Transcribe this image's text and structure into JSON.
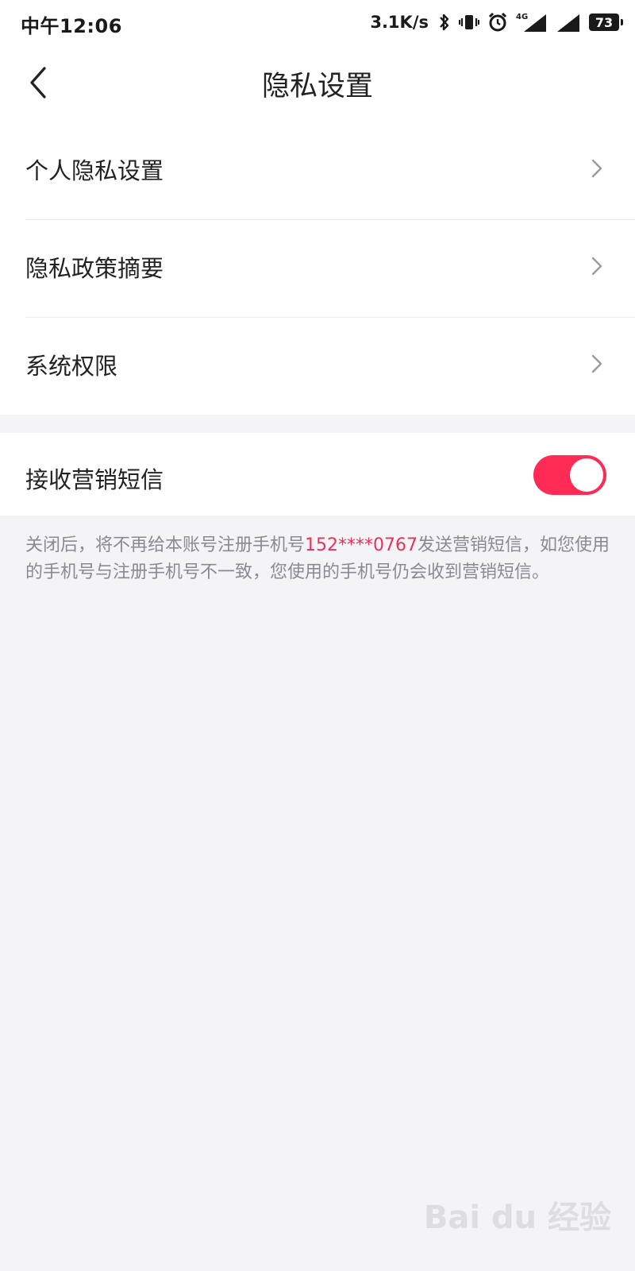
{
  "status_bar": {
    "time": "中午12:06",
    "network_speed": "3.1K/s",
    "network_type": "4G",
    "battery": "73",
    "icons": [
      "bluetooth-icon",
      "vibrate-icon",
      "alarm-icon",
      "signal-icon",
      "signal-icon",
      "battery-icon"
    ]
  },
  "header": {
    "title": "隐私设置",
    "back_icon": "chevron-left-icon"
  },
  "menu": {
    "items": [
      {
        "label": "个人隐私设置"
      },
      {
        "label": "隐私政策摘要"
      },
      {
        "label": "系统权限"
      }
    ]
  },
  "marketing_sms": {
    "label": "接收营销短信",
    "enabled": true,
    "note_prefix": "关闭后，将不再给本账号注册手机号",
    "phone": "152****0767",
    "note_suffix": "发送营销短信，如您使用的手机号与注册手机号不一致，您使用的手机号仍会收到营销短信。"
  },
  "watermark": "Bai du 经验",
  "colors": {
    "accent": "#fe2c55",
    "phone_highlight": "#e8325a",
    "background": "#f4f4f6"
  }
}
